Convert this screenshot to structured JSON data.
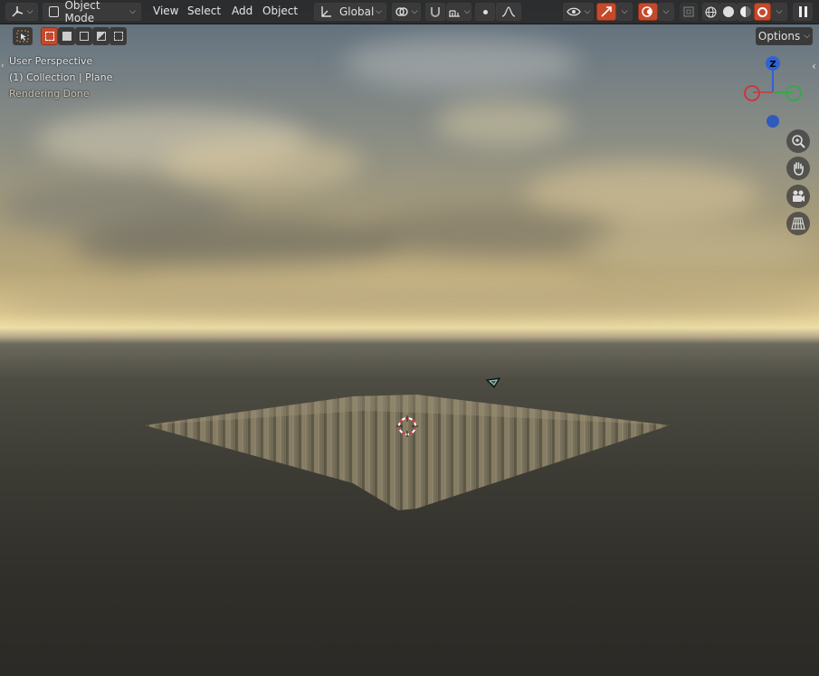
{
  "header": {
    "editor_type_icon": "viewport-axes-icon",
    "mode_label": "Object Mode",
    "menus": [
      "View",
      "Select",
      "Add",
      "Object"
    ],
    "transform_orientation": "Global",
    "options_label": "Options"
  },
  "overlay": {
    "view_name": "User Perspective",
    "collection_info": "(1) Collection | Plane",
    "render_status": "Rendering Done"
  },
  "gizmo": {
    "z_label": "Z",
    "colors": {
      "x": "#c83a3a",
      "y": "#3aa64a",
      "z": "#2f62d6",
      "neg_z": "#2f5bbb"
    }
  },
  "colors": {
    "accent_red": "#c54a2c",
    "header_bg": "#282828",
    "cursor_red": "#d23232"
  }
}
